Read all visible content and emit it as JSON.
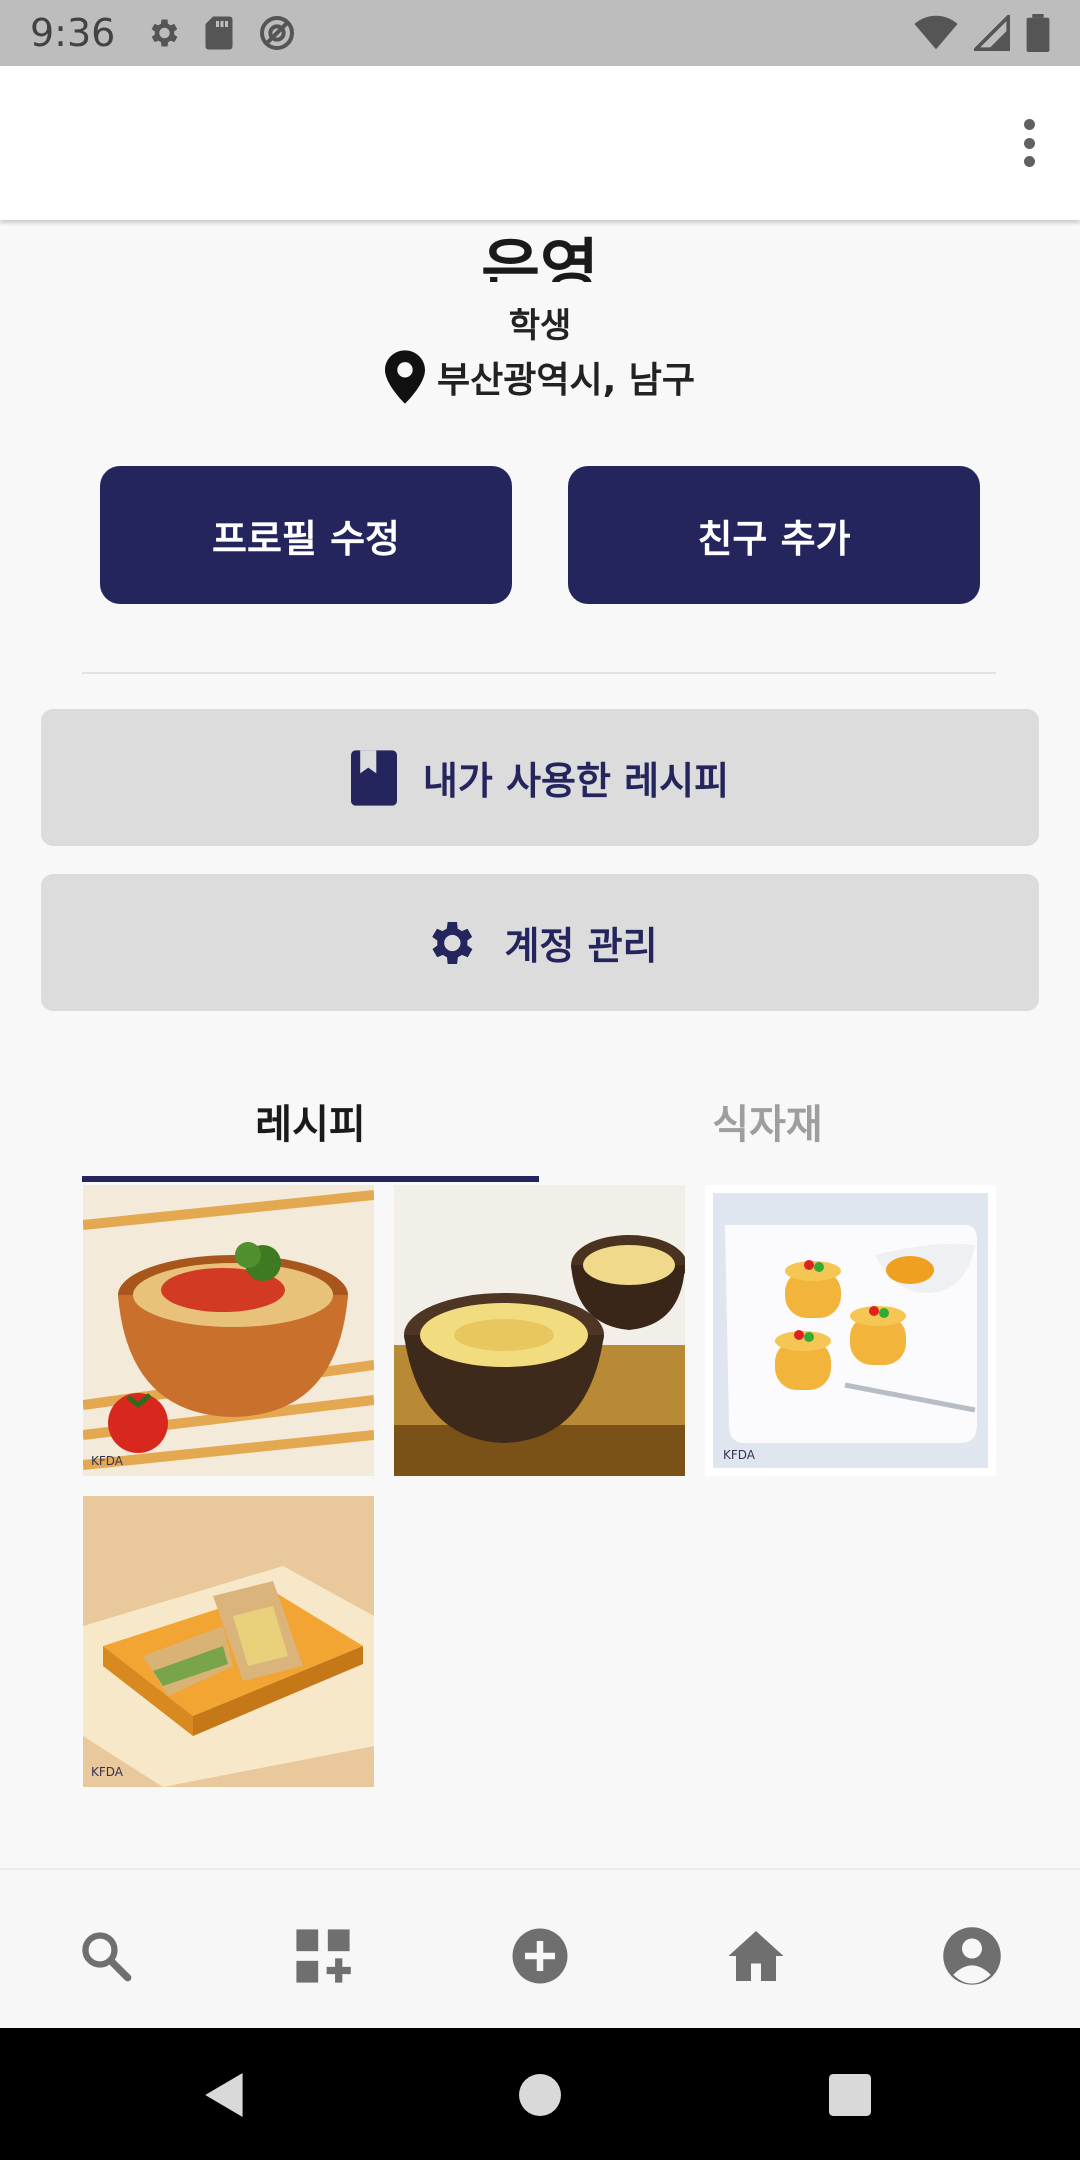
{
  "status_bar": {
    "time": "9:36"
  },
  "profile": {
    "name": "은영",
    "role": "학생",
    "location": "부산광역시, 남구"
  },
  "actions": {
    "edit_profile": "프로필 수정",
    "add_friend": "친구 추가"
  },
  "menu": {
    "used_recipes": "내가 사용한 레시피",
    "account": "계정 관리"
  },
  "tabs": [
    {
      "label": "레시피",
      "active": true
    },
    {
      "label": "식자재",
      "active": false
    }
  ],
  "recipe_thumbnails": [
    {
      "icon": "tomato-rice-bowl"
    },
    {
      "icon": "porridge-bowls"
    },
    {
      "icon": "mini-cakes-plate"
    },
    {
      "icon": "sandwich-plate"
    }
  ],
  "bottom_nav": [
    {
      "icon": "search-icon"
    },
    {
      "icon": "add-grid-icon"
    },
    {
      "icon": "add-circle-icon"
    },
    {
      "icon": "home-icon"
    },
    {
      "icon": "account-icon"
    }
  ],
  "colors": {
    "primary": "#25255e",
    "menu_bg": "#dcdcdc",
    "nav_icon": "#6f6f6f"
  }
}
